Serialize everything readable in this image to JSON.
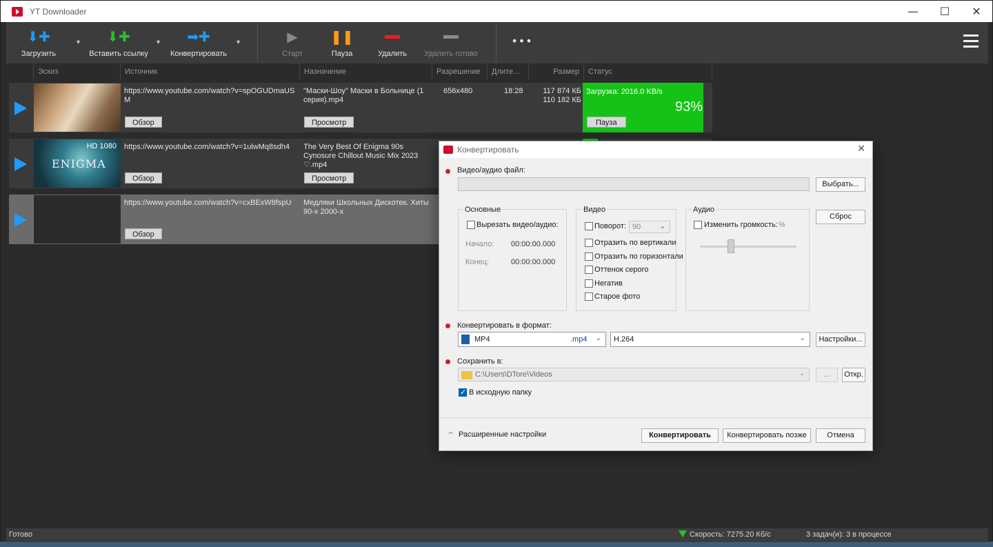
{
  "app": {
    "title": "YT Downloader"
  },
  "window_controls": {
    "minimize": "—",
    "maximize": "☐",
    "close": "✕"
  },
  "toolbar": {
    "download": "Загрузить",
    "paste_link": "Вставить ссылку",
    "convert": "Конвертировать",
    "start": "Старт",
    "pause": "Пауза",
    "delete": "Удалить",
    "delete_done": "Удалить готово",
    "more": "•••",
    "caret": "▾"
  },
  "columns": [
    "Эскиз",
    "Источник",
    "Назначение",
    "Разрешение",
    "Длите...",
    "Размер",
    "Статус"
  ],
  "rows": [
    {
      "source": "https://www.youtube.com/watch?v=spOGUDmaUSM",
      "dest": "\"Маски-Шоу\" Маски в Больнице (1 серия).mp4",
      "resolution": "656x480",
      "duration": "18:28",
      "size1": "117 874 КБ",
      "size2": "110 182 КБ",
      "status": "Загрузка: 2016.0 KB/s",
      "progress_percent": 93,
      "progress_label": "93%",
      "browse": "Обзор",
      "preview": "Просмотр",
      "pause": "Пауза"
    },
    {
      "source": "https://www.youtube.com/watch?v=1ulwMq8sdh4",
      "dest": "The Very Best Of Enigma 90s Cynosure Chillout Music Mix 2023 ♡.mp4",
      "thumb_badge": "HD 1080",
      "thumb_title": "ENIGMA",
      "browse": "Обзор",
      "preview": "Просмотр"
    },
    {
      "source": "https://www.youtube.com/watch?v=cxBExW8fspU",
      "dest": "Медляки Школьных Дискотек. Хиты 90-х 2000-х",
      "browse": "Обзор"
    }
  ],
  "statusbar": {
    "ready": "Готово",
    "speed": "Скорость: 7275.20 Кб/с",
    "tasks": "3 задач(и): 3 в процессе"
  },
  "dialog": {
    "title": "Конвертировать",
    "close": "✕",
    "file_label": "Видео/аудио файл:",
    "choose": "Выбрать...",
    "reset": "Сброс",
    "groups": {
      "basic": "Основные",
      "video": "Видео",
      "audio": "Аудио"
    },
    "cut": "Вырезать видео/аудио:",
    "start_label": "Начало:",
    "end_label": "Конец:",
    "start_time": "00:00:00.000",
    "end_time": "00:00:00.000",
    "rotate": "Поворот:",
    "rotate_value": "90",
    "flip_v": "Отразить по вертикали",
    "flip_h": "Отразить по горизонтали",
    "gray": "Оттенок серого",
    "negative": "Негатив",
    "old_photo": "Старое фото",
    "volume": "Изменить громкость:",
    "volume_unit": "%",
    "format_label": "Конвертировать в формат:",
    "format": "MP4",
    "format_ext": ".mp4",
    "codec": "H.264",
    "settings": "Настройки...",
    "save_label": "Сохранить в:",
    "save_path": "C:\\Users\\DTore\\Videos",
    "dots": "...",
    "open": "Откр.",
    "source_folder": "В исходную папку",
    "advanced": "Расширенные настройки",
    "advanced_icon": "^",
    "convert": "Конвертировать",
    "convert_later": "Конвертировать позже",
    "cancel": "Отмена"
  },
  "colors": {
    "accent_blue": "#1e9bff",
    "progress_green": "#15c316",
    "red_dot": "#d01f1f"
  }
}
